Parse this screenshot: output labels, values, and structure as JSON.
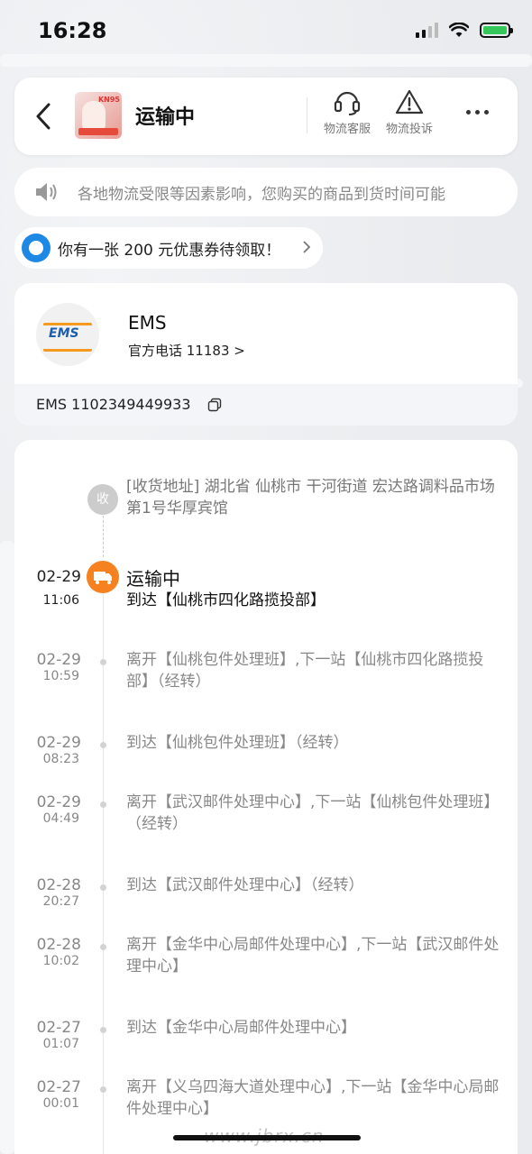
{
  "status_bar": {
    "time": "16:28"
  },
  "header": {
    "title": "运输中",
    "actions": [
      {
        "label": "物流客服",
        "icon": "headset-icon"
      },
      {
        "label": "物流投诉",
        "icon": "warning-icon"
      }
    ],
    "more_icon": "more-icon"
  },
  "notice": {
    "text": "各地物流受限等因素影响，您购买的商品到货时间可能"
  },
  "coupon": {
    "text": "你有一张 200 元优惠券待领取！"
  },
  "carrier": {
    "name": "EMS",
    "logo_text": "EMS",
    "phone": "官方电话 11183 >",
    "tracking": "EMS 1102349449933"
  },
  "timeline": {
    "receiver_label": "收",
    "address": "[收货地址] 湖北省 仙桃市  干河街道   宏达路调料品市场第1号华厚宾馆",
    "events": [
      {
        "date": "02-29",
        "time": "11:06",
        "status": "运输中",
        "text": "到达【仙桃市四化路揽投部】"
      },
      {
        "date": "02-29",
        "time": "10:59",
        "text": "离开【仙桃包件处理班】,下一站【仙桃市四化路揽投部】（经转）"
      },
      {
        "date": "02-29",
        "time": "08:23",
        "text": "到达【仙桃包件处理班】（经转）"
      },
      {
        "date": "02-29",
        "time": "04:49",
        "text": "离开【武汉邮件处理中心】,下一站【仙桃包件处理班】（经转）"
      },
      {
        "date": "02-28",
        "time": "20:27",
        "text": "到达【武汉邮件处理中心】（经转）"
      },
      {
        "date": "02-28",
        "time": "10:02",
        "text": "离开【金华中心局邮件处理中心】,下一站【武汉邮件处理中心】"
      },
      {
        "date": "02-27",
        "time": "01:07",
        "text": "到达【金华中心局邮件处理中心】"
      },
      {
        "date": "02-27",
        "time": "00:01",
        "text": "离开【义乌四海大道处理中心】,下一站【金华中心局邮件处理中心】"
      }
    ]
  },
  "watermark": "www.jbrx.cn",
  "colors": {
    "accent": "#f5811f",
    "battery": "#34c759"
  }
}
